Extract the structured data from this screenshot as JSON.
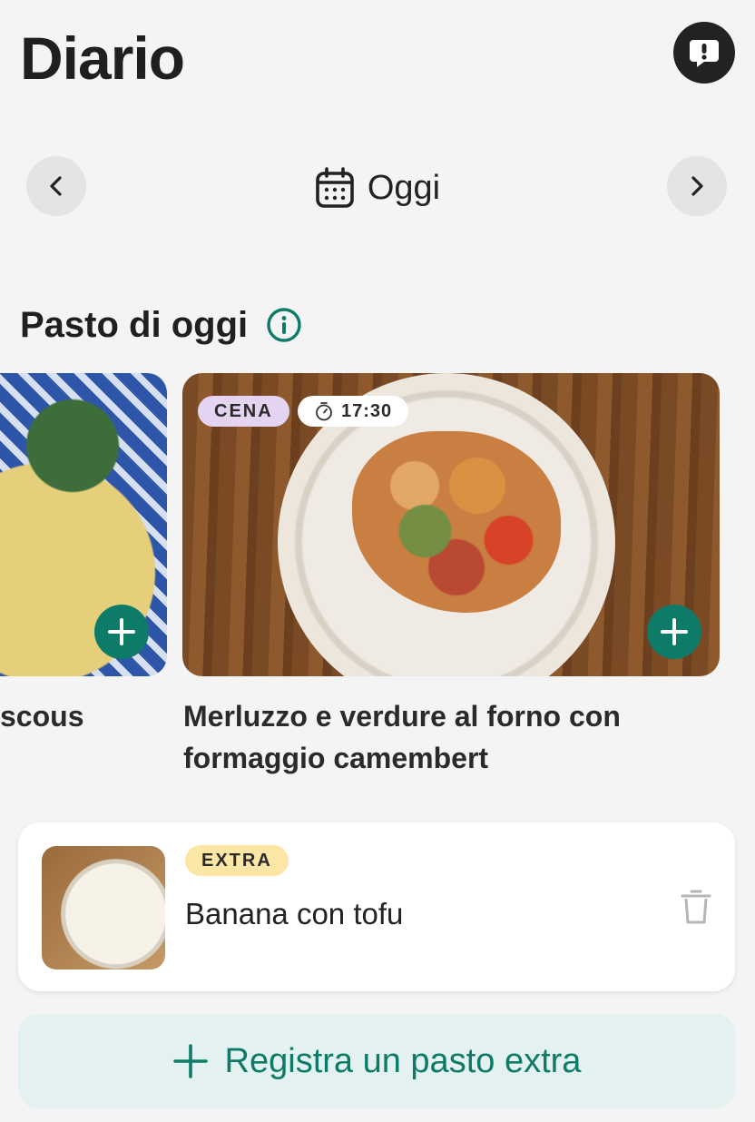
{
  "header": {
    "title": "Diario",
    "feedback_icon": "exclamation-bubble-icon"
  },
  "date_nav": {
    "prev_icon": "chevron-left-icon",
    "next_icon": "chevron-right-icon",
    "calendar_icon": "calendar-icon",
    "label": "Oggi"
  },
  "section": {
    "title": "Pasto di oggi",
    "info_icon": "info-icon"
  },
  "meals": [
    {
      "name": "scous"
    },
    {
      "type_badge": "CENA",
      "time": "17:30",
      "name": "Merluzzo e verdure al forno con formaggio camembert"
    }
  ],
  "extra": {
    "badge": "EXTRA",
    "name": "Banana con tofu",
    "delete_icon": "trash-icon"
  },
  "register_extra": {
    "label": "Registra un pasto extra",
    "icon": "plus-icon"
  },
  "colors": {
    "accent": "#0e7a68",
    "background": "#f4f4f4",
    "cena_badge": "#e5d3f2",
    "extra_badge": "#fbe6a6",
    "register_bg": "#e3f2f1"
  }
}
